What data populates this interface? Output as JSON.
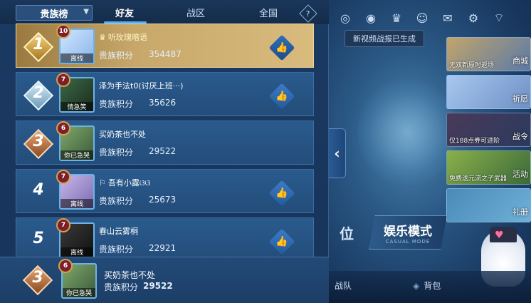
{
  "tabs": {
    "dropdown_label": "贵族榜",
    "friends": "好友",
    "region": "战区",
    "national": "全国"
  },
  "rows": [
    {
      "rank": "1",
      "level": "10",
      "status": "离线",
      "name": "听玫瑰暗语",
      "name_prefix_icon": "crown-icon",
      "score_label": "贵族积分",
      "score": "354487",
      "like": true
    },
    {
      "rank": "2",
      "level": "7",
      "status": "情急笑",
      "name": "泽为手法t0(讨厌上班···)",
      "score_label": "贵族积分",
      "score": "35626",
      "like": true
    },
    {
      "rank": "3",
      "level": "6",
      "status": "你已急哭",
      "name": "买奶茶也不处",
      "score_label": "贵族积分",
      "score": "29522",
      "like": false
    },
    {
      "rank": "4",
      "level": "7",
      "status": "离线",
      "name": "吾有小露ଓଓ",
      "name_prefix_icon": "flag-icon",
      "score_label": "贵族积分",
      "score": "25673",
      "like": true
    },
    {
      "rank": "5",
      "level": "7",
      "status": "离线",
      "name": "春山云雾桐",
      "score_label": "贵族积分",
      "score": "22921",
      "like": true
    }
  ],
  "me": {
    "rank": "3",
    "level": "6",
    "status": "你已急哭",
    "name": "买奶茶也不处",
    "score_label": "贵族积分",
    "score": "29522"
  },
  "right": {
    "toast": "新视频战报已生成",
    "side_cards": [
      {
        "caption": "无双新原时返场",
        "label": "商城"
      },
      {
        "caption": "",
        "label": "祈愿"
      },
      {
        "caption": "仅188点券可进阶",
        "label": "战令"
      },
      {
        "caption": "免费送元流之子武器",
        "label": "活动"
      },
      {
        "caption": "",
        "label": "礼册"
      }
    ],
    "rank_mode": "位",
    "mode_title": "娱乐模式",
    "mode_sub": "CASUAL MODE",
    "bottom_team": "战队",
    "bottom_bag": "背包"
  },
  "colors": {
    "accent": "#4fb0ff",
    "gold_row": "#c7a86a",
    "row_bg": "#2a5a8d"
  }
}
